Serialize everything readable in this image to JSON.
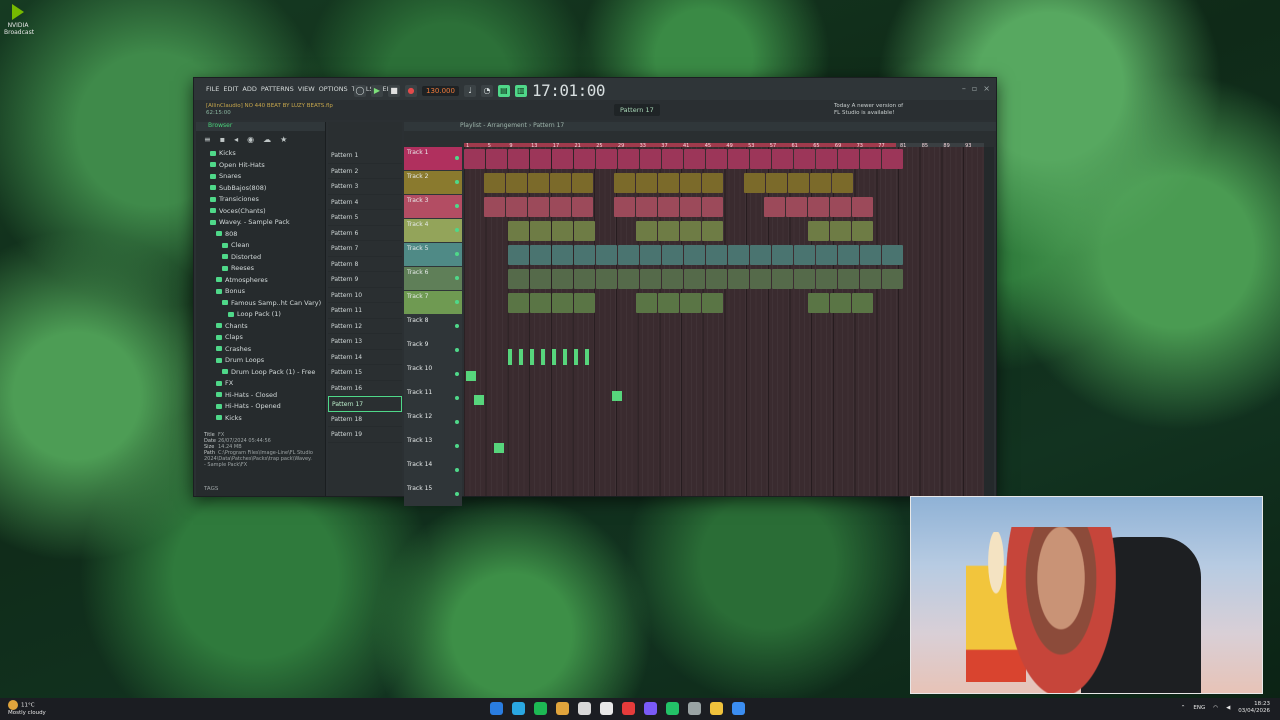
{
  "desktop": {
    "shortcut_label": "NVIDIA Broadcast"
  },
  "fl": {
    "menu": [
      "FILE",
      "EDIT",
      "ADD",
      "PATTERNS",
      "VIEW",
      "OPTIONS",
      "TOOLS",
      "HELP"
    ],
    "tempo": "130.000",
    "time": "17:01:00",
    "project_title": "[AllinClaudio] NO 440 BEAT BY LUZY BEATS.flp",
    "project_time": "62:15:00",
    "pattern_selector": "Pattern 17",
    "news_line1": "Today  A newer version of",
    "news_line2": "FL Studio is available!",
    "browser": {
      "title": "Browser",
      "items": [
        {
          "label": "Kicks",
          "depth": 1
        },
        {
          "label": "Open Hit-Hats",
          "depth": 1
        },
        {
          "label": "Snares",
          "depth": 1
        },
        {
          "label": "SubBajos(808)",
          "depth": 1
        },
        {
          "label": "Transiciones",
          "depth": 1
        },
        {
          "label": "Voces(Chants)",
          "depth": 1
        },
        {
          "label": "Wavey. - Sample Pack",
          "depth": 1
        },
        {
          "label": "808",
          "depth": 2
        },
        {
          "label": "Clean",
          "depth": 3
        },
        {
          "label": "Distorted",
          "depth": 3
        },
        {
          "label": "Reeses",
          "depth": 3
        },
        {
          "label": "Atmospheres",
          "depth": 2
        },
        {
          "label": "Bonus",
          "depth": 2
        },
        {
          "label": "Famous Samp..ht Can Vary)",
          "depth": 3
        },
        {
          "label": "Loop Pack (1)",
          "depth": 4
        },
        {
          "label": "Chants",
          "depth": 2
        },
        {
          "label": "Claps",
          "depth": 2
        },
        {
          "label": "Crashes",
          "depth": 2
        },
        {
          "label": "Drum Loops",
          "depth": 2
        },
        {
          "label": "Drum Loop Pack (1) - Free",
          "depth": 3
        },
        {
          "label": "FX",
          "depth": 2
        },
        {
          "label": "Hi-Hats - Closed",
          "depth": 2
        },
        {
          "label": "Hi-Hats - Opened",
          "depth": 2
        },
        {
          "label": "Kicks",
          "depth": 2
        }
      ],
      "info": {
        "title_k": "Title",
        "title_v": "FX",
        "date_k": "Date",
        "date_v": "26/07/2024 05:44:56",
        "size_k": "Size",
        "size_v": "14.24 MB",
        "path_k": "Path",
        "path_v": "C:\\Program Files\\Image-Line\\FL Studio 2024\\Data\\Patches\\Packs\\trap pack\\Wavey. - Sample Pack\\FX"
      },
      "tags": "TAGS"
    },
    "patterns": [
      "Pattern 1",
      "Pattern 2",
      "Pattern 3",
      "Pattern 4",
      "Pattern 5",
      "Pattern 6",
      "Pattern 7",
      "Pattern 8",
      "Pattern 9",
      "Pattern 10",
      "Pattern 11",
      "Pattern 12",
      "Pattern 13",
      "Pattern 14",
      "Pattern 15",
      "Pattern 16",
      "Pattern 17",
      "Pattern 18",
      "Pattern 19"
    ],
    "playlist_title": "Playlist - Arrangement › Pattern 17",
    "tracks": [
      "Track 1",
      "Track 2",
      "Track 3",
      "Track 4",
      "Track 5",
      "Track 6",
      "Track 7",
      "Track 8",
      "Track 9",
      "Track 10",
      "Track 11",
      "Track 12",
      "Track 13",
      "Track 14",
      "Track 15"
    ],
    "track_colors": [
      "#b0305e",
      "#8a7a2e",
      "#b34d63",
      "#93a45a",
      "#4f8a86",
      "#5f7f58",
      "#6f9a52",
      "#2f3538",
      "#2f3538",
      "#2f3538",
      "#2f3538",
      "#2f3538",
      "#2f3538",
      "#2f3538",
      "#2f3538"
    ],
    "ruler": [
      "1",
      "5",
      "9",
      "13",
      "17",
      "21",
      "25",
      "29",
      "33",
      "37",
      "41",
      "45",
      "49",
      "53",
      "57",
      "61",
      "65",
      "69",
      "73",
      "77",
      "81",
      "85",
      "89",
      "93"
    ]
  },
  "taskbar": {
    "weather_temp": "11°C",
    "weather_desc": "Mostly cloudy",
    "lang": "ENG",
    "time": "18:23",
    "date": "03/04/2026",
    "app_colors": [
      "#2a7de1",
      "#2aa7e1",
      "#1db954",
      "#e0a43c",
      "#d8d8d8",
      "#e8e8e8",
      "#e63b3b",
      "#7a5af8",
      "#23c268",
      "#9aa3a4",
      "#f0c23c",
      "#3b8df0"
    ]
  }
}
